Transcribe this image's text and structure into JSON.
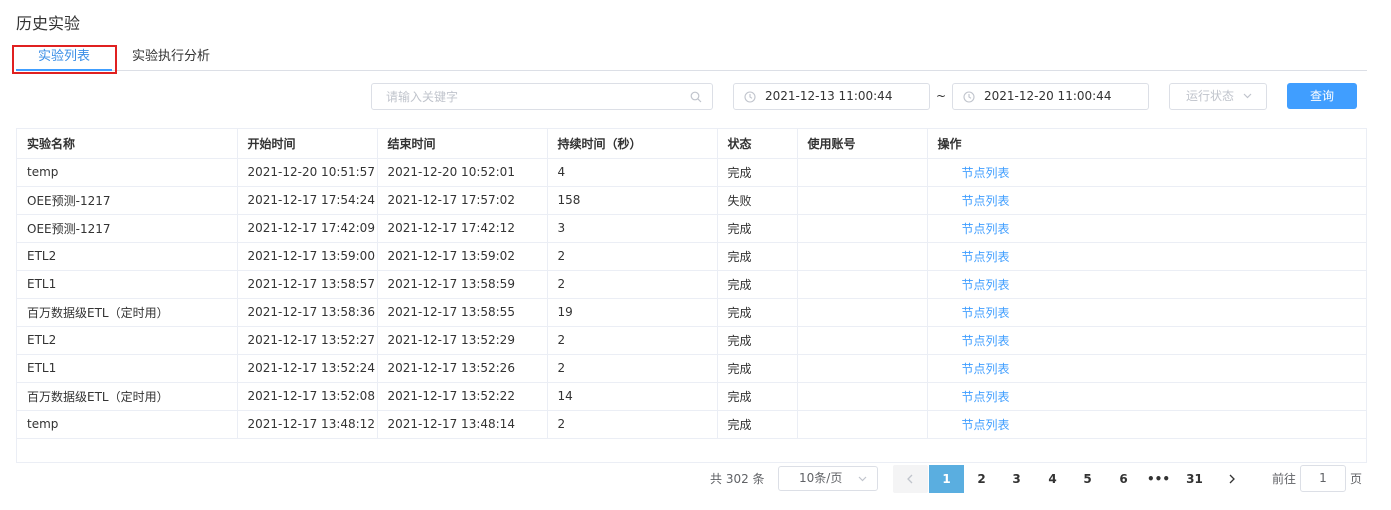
{
  "page": {
    "title": "历史实验"
  },
  "tabs": [
    {
      "label": "实验列表",
      "active": true
    },
    {
      "label": "实验执行分析",
      "active": false
    }
  ],
  "filters": {
    "search_placeholder": "请输入关键字",
    "date_start": "2021-12-13 11:00:44",
    "date_separator": "~",
    "date_end": "2021-12-20 11:00:44",
    "status_placeholder": "运行状态",
    "query_label": "查询"
  },
  "table": {
    "headers": [
      "实验名称",
      "开始时间",
      "结束时间",
      "持续时间（秒）",
      "状态",
      "使用账号",
      "操作"
    ],
    "rows": [
      {
        "name": "temp",
        "start": "2021-12-20 10:51:57",
        "end": "2021-12-20 10:52:01",
        "duration": "4",
        "status": "完成",
        "account": "",
        "action": "节点列表"
      },
      {
        "name": "OEE预测-1217",
        "start": "2021-12-17 17:54:24",
        "end": "2021-12-17 17:57:02",
        "duration": "158",
        "status": "失败",
        "account": "",
        "action": "节点列表"
      },
      {
        "name": "OEE预测-1217",
        "start": "2021-12-17 17:42:09",
        "end": "2021-12-17 17:42:12",
        "duration": "3",
        "status": "完成",
        "account": "",
        "action": "节点列表"
      },
      {
        "name": "ETL2",
        "start": "2021-12-17 13:59:00",
        "end": "2021-12-17 13:59:02",
        "duration": "2",
        "status": "完成",
        "account": "",
        "action": "节点列表"
      },
      {
        "name": "ETL1",
        "start": "2021-12-17 13:58:57",
        "end": "2021-12-17 13:58:59",
        "duration": "2",
        "status": "完成",
        "account": "",
        "action": "节点列表"
      },
      {
        "name": "百万数据级ETL（定时用）",
        "start": "2021-12-17 13:58:36",
        "end": "2021-12-17 13:58:55",
        "duration": "19",
        "status": "完成",
        "account": "",
        "action": "节点列表"
      },
      {
        "name": "ETL2",
        "start": "2021-12-17 13:52:27",
        "end": "2021-12-17 13:52:29",
        "duration": "2",
        "status": "完成",
        "account": "",
        "action": "节点列表"
      },
      {
        "name": "ETL1",
        "start": "2021-12-17 13:52:24",
        "end": "2021-12-17 13:52:26",
        "duration": "2",
        "status": "完成",
        "account": "",
        "action": "节点列表"
      },
      {
        "name": "百万数据级ETL（定时用）",
        "start": "2021-12-17 13:52:08",
        "end": "2021-12-17 13:52:22",
        "duration": "14",
        "status": "完成",
        "account": "",
        "action": "节点列表"
      },
      {
        "name": "temp",
        "start": "2021-12-17 13:48:12",
        "end": "2021-12-17 13:48:14",
        "duration": "2",
        "status": "完成",
        "account": "",
        "action": "节点列表"
      }
    ]
  },
  "pagination": {
    "total_text": "共 302 条",
    "page_size": "10条/页",
    "pages": [
      "1",
      "2",
      "3",
      "4",
      "5",
      "6",
      "•••",
      "31"
    ],
    "current": "1",
    "goto_label": "前往",
    "goto_value": "1",
    "page_unit": "页"
  },
  "colors": {
    "accent": "#409eff",
    "active_page": "#5aaee0",
    "tab_highlight_border": "#e02020"
  }
}
